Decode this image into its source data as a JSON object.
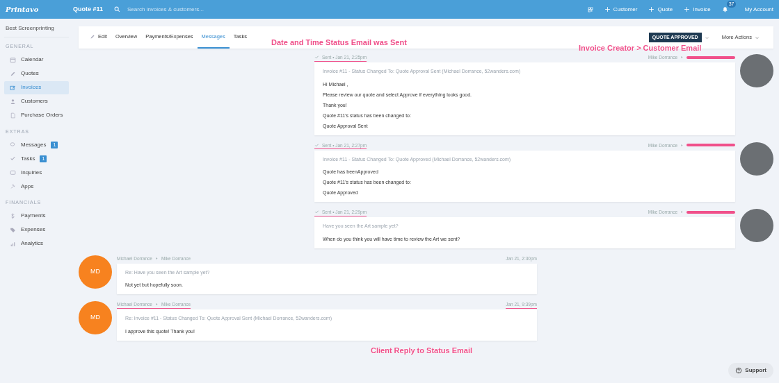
{
  "topbar": {
    "logo": "Printavo",
    "title": "Quote #11",
    "search": {
      "placeholder": "Search invoices & customers..."
    },
    "actions": [
      "Customer",
      "Quote",
      "Invoice"
    ],
    "notifications": "37",
    "account": "My Account"
  },
  "sidebar": {
    "company": "Best Screenprinting",
    "sections": [
      {
        "title": "GENERAL",
        "items": [
          {
            "label": "Calendar",
            "kind": "calendar",
            "selected": false
          },
          {
            "label": "Quotes",
            "kind": "pencil",
            "selected": false
          },
          {
            "label": "Invoices",
            "kind": "edit",
            "selected": true
          },
          {
            "label": "Customers",
            "kind": "person",
            "selected": false
          },
          {
            "label": "Purchase Orders",
            "kind": "document",
            "selected": false
          }
        ]
      },
      {
        "title": "EXTRAS",
        "items": [
          {
            "label": "Messages",
            "kind": "chat",
            "selected": false,
            "badge": "1"
          },
          {
            "label": "Tasks",
            "kind": "check",
            "selected": false,
            "badge": "1"
          },
          {
            "label": "Inquiries",
            "kind": "inbox",
            "selected": false
          },
          {
            "label": "Apps",
            "kind": "plug",
            "selected": false
          }
        ]
      },
      {
        "title": "FINANCIALS",
        "items": [
          {
            "label": "Payments",
            "kind": "dollar",
            "selected": false
          },
          {
            "label": "Expenses",
            "kind": "tag",
            "selected": false
          },
          {
            "label": "Analytics",
            "kind": "bars",
            "selected": false
          }
        ]
      }
    ]
  },
  "tabs": [
    {
      "label": "Edit",
      "kind": "pencil",
      "selected": false
    },
    {
      "label": "Overview",
      "selected": false
    },
    {
      "label": "Payments/Expenses",
      "selected": false
    },
    {
      "label": "Messages",
      "selected": true
    },
    {
      "label": "Tasks",
      "selected": false
    }
  ],
  "status": "QUOTE APPROVED",
  "more_actions": "More Actions",
  "annotations": [
    "Date and Time Status Email was Sent",
    "Invoice Creator > Customer Email",
    "Client Reply to Status Email"
  ],
  "messages": [
    {
      "kind": "sent",
      "status": "Sent • Jan 21, 2:25pm",
      "underlined": true,
      "sender": "Mike Dorrance",
      "subject": "Invoice #11 - Status Changed To: Quote Approval Sent (Michael Dorrance, 52wanders.com)",
      "lines": [
        "Hi Michael ,",
        "Please review our quote and select Approve if everything looks good.",
        "Thank you!",
        "Quote #11's status has been changed to:",
        "Quote Approval Sent"
      ]
    },
    {
      "kind": "sent",
      "status": "Sent • Jan 21, 2:27pm",
      "underlined": true,
      "sender": "Mike Dorrance",
      "subject": "Invoice #11 - Status Changed To: Quote Approved (Michael Dorrance, 52wanders.com)",
      "lines": [
        "Quote has beenApproved",
        "Quote #11's status has been changed to:",
        "Quote Approved"
      ]
    },
    {
      "kind": "sent",
      "status": "Sent • Jan 21, 2:29pm",
      "underlined": true,
      "sender": "Mike Dorrance",
      "subject": "Have you seen the Art sample yet?",
      "lines": [
        "When do you think you will have time to review the Art we sent?"
      ]
    },
    {
      "kind": "received",
      "initials": "MD",
      "sender": "Michael Dorrance",
      "recipient": "Mike Dorrance",
      "time": "Jan 21, 2:30pm",
      "underlined": false,
      "subject": "Re: Have you seen the Art sample yet?",
      "lines": [
        "Not yet but hopefully soon."
      ]
    },
    {
      "kind": "received",
      "initials": "MD",
      "sender": "Michael Dorrance",
      "recipient": "Mike Dorrance",
      "time": "Jan 21, 9:39pm",
      "underlined": true,
      "subject": "Re: Invoice #11 - Status Changed To: Quote Approval Sent (Michael Dorrance, 52wanders.com)",
      "lines": [
        "I approve this quote! Thank you!"
      ]
    }
  ],
  "support": "Support"
}
